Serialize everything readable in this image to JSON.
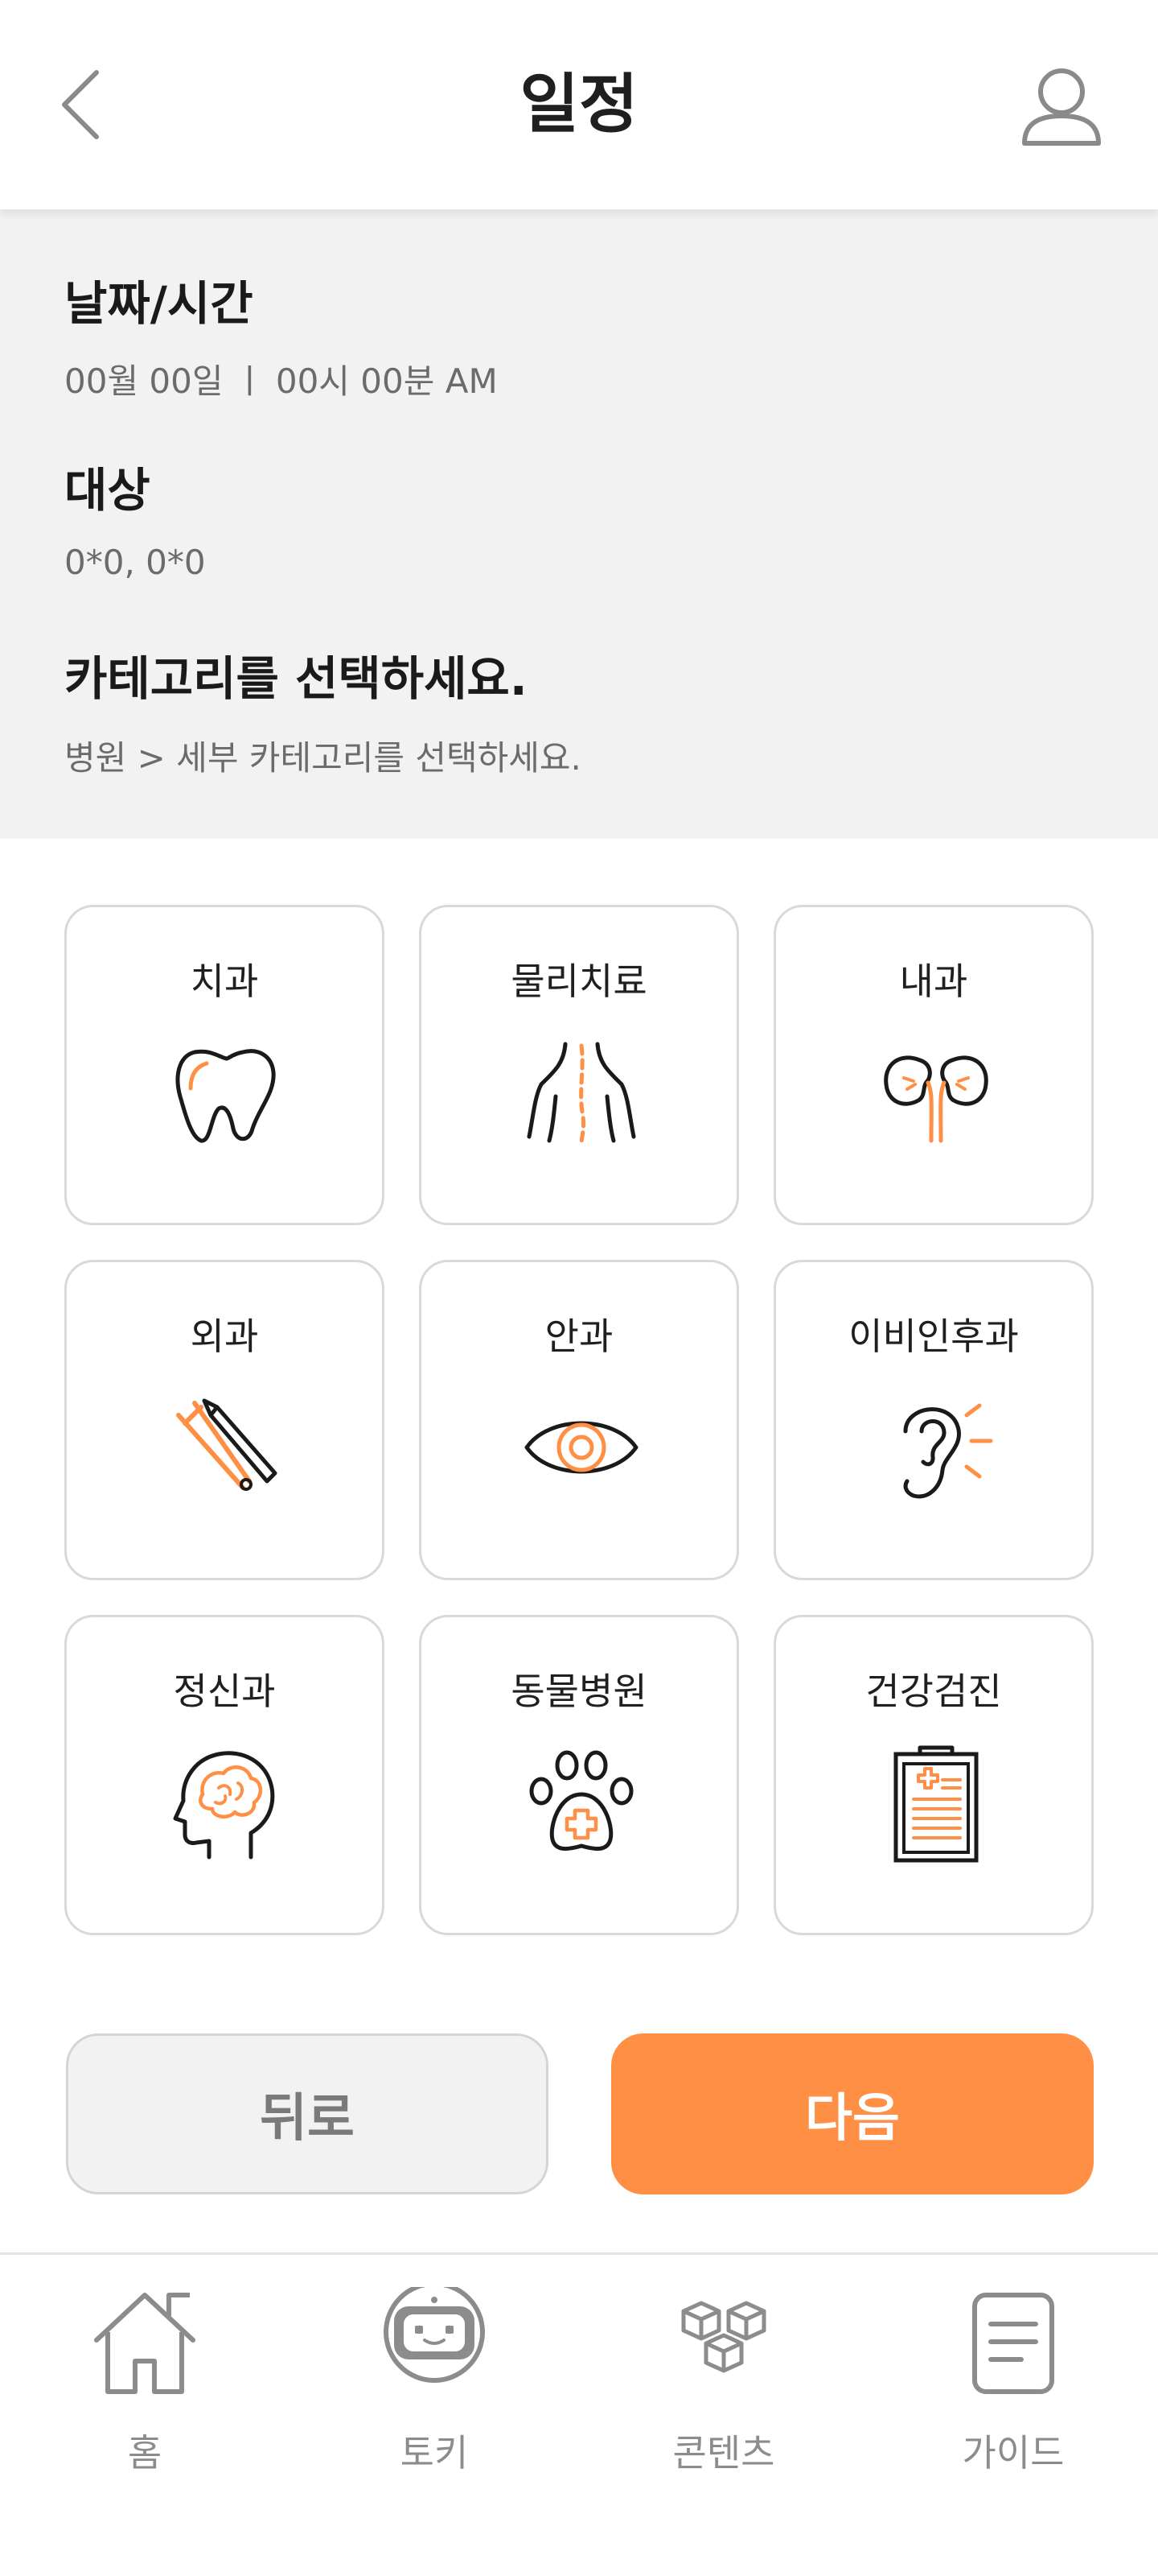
{
  "header": {
    "title": "일정"
  },
  "info": {
    "datetime_label": "날짜/시간",
    "datetime_value": "00월 00일 ㅣ 00시 00분  AM",
    "target_label": "대상",
    "target_value": "0*0, 0*0",
    "category_label": "카테고리를 선택하세요.",
    "category_value": "병원 > 세부 카테고리를 선택하세요."
  },
  "categories": [
    {
      "label": "치과",
      "icon": "tooth-icon"
    },
    {
      "label": "물리치료",
      "icon": "back-spine-icon"
    },
    {
      "label": "내과",
      "icon": "kidney-icon"
    },
    {
      "label": "외과",
      "icon": "surgical-tools-icon"
    },
    {
      "label": "안과",
      "icon": "eye-icon"
    },
    {
      "label": "이비인후과",
      "icon": "ear-icon"
    },
    {
      "label": "정신과",
      "icon": "head-brain-icon"
    },
    {
      "label": "동물병원",
      "icon": "paw-cross-icon"
    },
    {
      "label": "건강검진",
      "icon": "clipboard-icon"
    }
  ],
  "buttons": {
    "back": "뒤로",
    "next": "다음"
  },
  "nav": [
    {
      "label": "홈",
      "icon": "home-icon"
    },
    {
      "label": "토키",
      "icon": "robot-icon"
    },
    {
      "label": "콘텐츠",
      "icon": "cubes-icon"
    },
    {
      "label": "가이드",
      "icon": "document-icon"
    }
  ],
  "colors": {
    "accent": "#ff8f45",
    "line": "#1a1a1a",
    "muted": "#8c8c8c",
    "panel": "#f2f2f2"
  }
}
